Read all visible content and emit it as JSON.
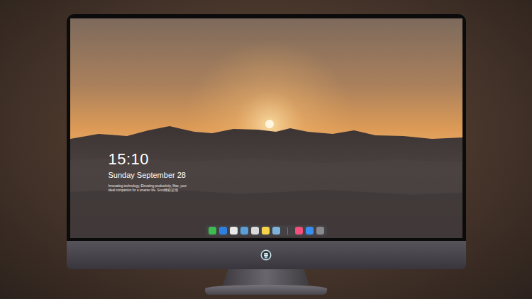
{
  "desktop": {
    "clock": "15:10",
    "date": "Sunday September 28",
    "tagline": "Innovating technology, Elevating productivity, Mac, your ideal companion for a smarter life. Sxxx精彩呈现"
  },
  "dock": [
    {
      "kind": "app",
      "color": "#3dbb4f"
    },
    {
      "kind": "app",
      "color": "#2f7fe0"
    },
    {
      "kind": "app",
      "color": "#e8e8e8"
    },
    {
      "kind": "app",
      "color": "#5aa0d8"
    },
    {
      "kind": "app",
      "color": "#d9d9d9"
    },
    {
      "kind": "app",
      "color": "#f5d44a"
    },
    {
      "kind": "app",
      "color": "#7fb2d9"
    },
    {
      "kind": "separator"
    },
    {
      "kind": "app",
      "color": "#f0507a"
    },
    {
      "kind": "app",
      "color": "#3a8ef0"
    },
    {
      "kind": "app",
      "color": "#8a8a8e"
    }
  ]
}
